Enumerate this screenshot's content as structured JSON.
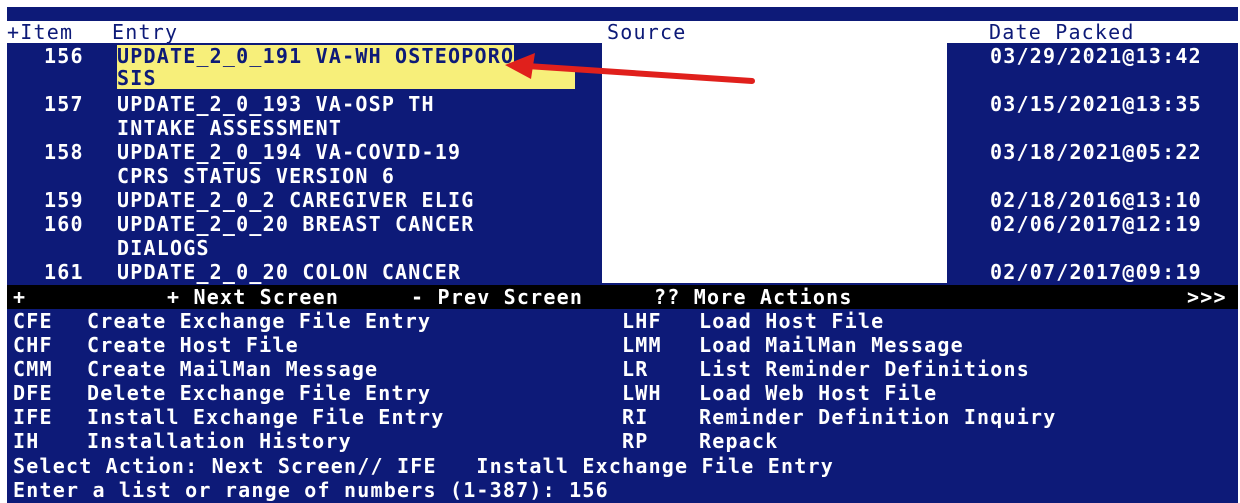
{
  "header": {
    "item": "+Item",
    "entry": "Entry",
    "source": "Source",
    "date": "Date Packed"
  },
  "rows": [
    {
      "num": "156",
      "entry1": "UPDATE_2_0_191 VA-WH OSTEOPORO",
      "entry2": "SIS",
      "date": "03/29/2021@13:42",
      "highlight": true
    },
    {
      "num": "157",
      "entry1": "UPDATE_2_0_193 VA-OSP TH",
      "entry2": "INTAKE ASSESSMENT",
      "date": "03/15/2021@13:35"
    },
    {
      "num": "158",
      "entry1": "UPDATE_2_0_194 VA-COVID-19",
      "entry2": "CPRS STATUS VERSION 6",
      "date": "03/18/2021@05:22"
    },
    {
      "num": "159",
      "entry1": "UPDATE_2_0_2 CAREGIVER ELIG",
      "entry2": "",
      "date": "02/18/2016@13:10"
    },
    {
      "num": "160",
      "entry1": "UPDATE_2_0_20 BREAST CANCER",
      "entry2": "DIALOGS",
      "date": "02/06/2017@12:19"
    },
    {
      "num": "161",
      "entry1": "UPDATE_2_0_20 COLON CANCER",
      "entry2": "",
      "date": "02/07/2017@09:19"
    }
  ],
  "nav_bar": {
    "plus": "+",
    "next": "+ Next Screen",
    "prev": "- Prev Screen",
    "more": "?? More Actions",
    "more_indicator": ">>>"
  },
  "actions_left": [
    {
      "code": "CFE",
      "label": "Create Exchange File Entry"
    },
    {
      "code": "CHF",
      "label": "Create Host File"
    },
    {
      "code": "CMM",
      "label": "Create MailMan Message"
    },
    {
      "code": "DFE",
      "label": "Delete Exchange File Entry"
    },
    {
      "code": "IFE",
      "label": "Install Exchange File Entry"
    },
    {
      "code": "IH",
      "label": "Installation History"
    }
  ],
  "actions_right": [
    {
      "code": "LHF",
      "label": "Load Host File"
    },
    {
      "code": "LMM",
      "label": "Load MailMan Message"
    },
    {
      "code": "LR",
      "label": "List Reminder Definitions"
    },
    {
      "code": "LWH",
      "label": "Load Web Host File"
    },
    {
      "code": "RI",
      "label": "Reminder Definition Inquiry"
    },
    {
      "code": "RP",
      "label": "Repack"
    }
  ],
  "prompt": {
    "select_action": "Select Action: Next Screen// IFE   Install Exchange File Entry",
    "enter_list": "Enter a list or range of numbers (1-387): 156"
  },
  "colors": {
    "background": "#0d1a78",
    "highlight": "#f7ef7a",
    "arrow": "#e0201c",
    "bar": "#000000"
  }
}
